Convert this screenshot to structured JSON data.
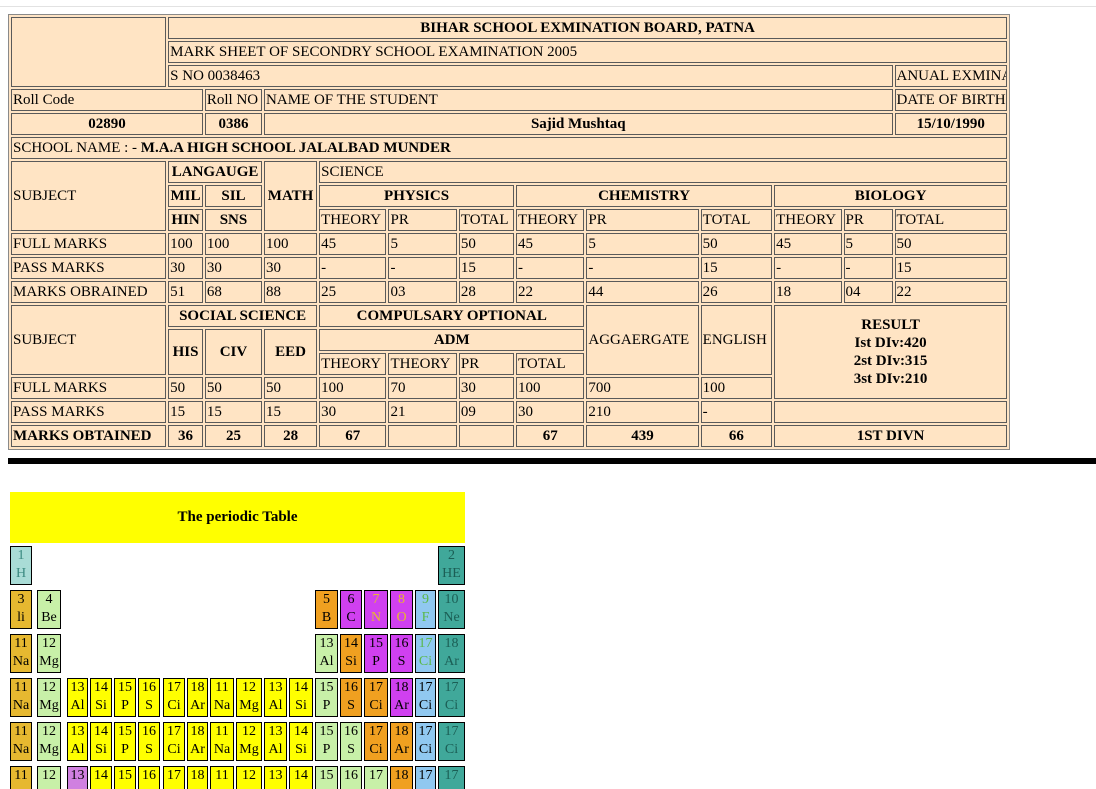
{
  "marksheet": {
    "board": "BIHAR SCHOOL EXMINATION BOARD, PATNA",
    "sheet_title": "MARK SHEET OF SECONDRY SCHOOL EXAMINATION 2005",
    "serial_no": "S NO 0038463",
    "exam_type": "ANUAL EXMINATION",
    "labels": {
      "roll_code": "Roll Code",
      "roll_no": "Roll NO",
      "student_name": "NAME OF THE STUDENT",
      "dob": "DATE OF BIRTH",
      "school_prefix": "SCHOOL NAME : -",
      "subject": "SUBJECT",
      "language": "LANGAUGE",
      "mil": "MIL",
      "sil": "SIL",
      "hin": "HIN",
      "sns": "SNS",
      "math": "MATH",
      "science": "SCIENCE",
      "physics": "PHYSICS",
      "chemistry": "CHEMISTRY",
      "biology": "BIOLOGY",
      "theory": "THEORY",
      "pr": "PR",
      "total": "TOTAL",
      "full_marks": "FULL MARKS",
      "pass_marks": "PASS MARKS",
      "marks_obrained": "MARKS OBRAINED",
      "marks_obtained": "MARKS OBTAINED",
      "social_science": "SOCIAL SCIENCE",
      "his": "HIS",
      "civ": "CIV",
      "eed": "EED",
      "compulsary_optional": "COMPULSARY OPTIONAL",
      "adm": "ADM",
      "aggregate": "AGGAERGATE",
      "english": "ENGLISH",
      "result": "RESULT",
      "div1": "Ist DIv:420",
      "div2": "2st DIv:315",
      "div3": "3st DIv:210"
    },
    "student": {
      "roll_code": "02890",
      "roll_no": "0386",
      "name": "Sajid Mushtaq",
      "dob": "15/10/1990",
      "school": "M.A.A HIGH SCHOOL JALALBAD MUNDER"
    },
    "part1": {
      "full": [
        "100",
        "100",
        "100",
        "45",
        "5",
        "50",
        "45",
        "5",
        "50",
        "45",
        "5",
        "50"
      ],
      "pass": [
        "30",
        "30",
        "30",
        "-",
        "-",
        "15",
        "-",
        "-",
        "15",
        "-",
        "-",
        "15"
      ],
      "obt": [
        "51",
        "68",
        "88",
        "25",
        "03",
        "28",
        "22",
        "44",
        "26",
        "18",
        "04",
        "22"
      ]
    },
    "part2": {
      "full": [
        "50",
        "50",
        "50",
        "100",
        "70",
        "30",
        "100",
        "700",
        "100"
      ],
      "pass": [
        "15",
        "15",
        "15",
        "30",
        "21",
        "09",
        "30",
        "210",
        "-"
      ],
      "obt": [
        "36",
        "25",
        "28",
        "67",
        "",
        "",
        "67",
        "439",
        "66"
      ],
      "result": "1ST DIVN"
    }
  },
  "periodic": {
    "title": "The periodic Table",
    "rows": [
      [
        {
          "col": 0,
          "n": "1",
          "s": "H",
          "bg": "#a9dcd6",
          "fg": "#3b8a80"
        },
        {
          "col": 17,
          "n": "2",
          "s": "HE",
          "bg": "#40a89a",
          "fg": "#1b5e55"
        }
      ],
      [
        {
          "col": 0,
          "n": "3",
          "s": "li",
          "bg": "#e6b830",
          "fg": "#000"
        },
        {
          "col": 1,
          "n": "4",
          "s": "Be",
          "bg": "#c8f0a8",
          "fg": "#000"
        },
        {
          "col": 12,
          "n": "5",
          "s": "B",
          "bg": "#f0a020",
          "fg": "#000"
        },
        {
          "col": 13,
          "n": "6",
          "s": "C",
          "bg": "#d040f0",
          "fg": "#000"
        },
        {
          "col": 14,
          "n": "7",
          "s": "N",
          "bg": "#d040f0",
          "fg": "#e6b830"
        },
        {
          "col": 15,
          "n": "8",
          "s": "O",
          "bg": "#d040f0",
          "fg": "#e6b830"
        },
        {
          "col": 16,
          "n": "9",
          "s": "F",
          "bg": "#90c8f0",
          "fg": "#5ab84a"
        },
        {
          "col": 17,
          "n": "10",
          "s": "Ne",
          "bg": "#40a89a",
          "fg": "#1b5e55"
        }
      ],
      [
        {
          "col": 0,
          "n": "11",
          "s": "Na",
          "bg": "#e6b830",
          "fg": "#000"
        },
        {
          "col": 1,
          "n": "12",
          "s": "Mg",
          "bg": "#c8f0a8",
          "fg": "#000"
        },
        {
          "col": 12,
          "n": "13",
          "s": "Al",
          "bg": "#c8f0a8",
          "fg": "#000"
        },
        {
          "col": 13,
          "n": "14",
          "s": "Si",
          "bg": "#f0a020",
          "fg": "#000"
        },
        {
          "col": 14,
          "n": "15",
          "s": "P",
          "bg": "#d040f0",
          "fg": "#000"
        },
        {
          "col": 15,
          "n": "16",
          "s": "S",
          "bg": "#d040f0",
          "fg": "#000"
        },
        {
          "col": 16,
          "n": "17",
          "s": "Ci",
          "bg": "#90c8f0",
          "fg": "#5ab84a"
        },
        {
          "col": 17,
          "n": "18",
          "s": "Ar",
          "bg": "#40a89a",
          "fg": "#1b5e55"
        }
      ],
      [
        {
          "col": 0,
          "n": "11",
          "s": "Na",
          "bg": "#e6b830",
          "fg": "#000"
        },
        {
          "col": 1,
          "n": "12",
          "s": "Mg",
          "bg": "#c8f0a8",
          "fg": "#000"
        },
        {
          "col": 2,
          "n": "13",
          "s": "Al",
          "bg": "#ffff00",
          "fg": "#000"
        },
        {
          "col": 3,
          "n": "14",
          "s": "Si",
          "bg": "#ffff00",
          "fg": "#000"
        },
        {
          "col": 4,
          "n": "15",
          "s": "P",
          "bg": "#ffff00",
          "fg": "#000"
        },
        {
          "col": 5,
          "n": "16",
          "s": "S",
          "bg": "#ffff00",
          "fg": "#000"
        },
        {
          "col": 6,
          "n": "17",
          "s": "Ci",
          "bg": "#ffff00",
          "fg": "#000"
        },
        {
          "col": 7,
          "n": "18",
          "s": "Ar",
          "bg": "#ffff00",
          "fg": "#000"
        },
        {
          "col": 8,
          "n": "11",
          "s": "Na",
          "bg": "#ffff00",
          "fg": "#000"
        },
        {
          "col": 9,
          "n": "12",
          "s": "Mg",
          "bg": "#ffff00",
          "fg": "#000"
        },
        {
          "col": 10,
          "n": "13",
          "s": "Al",
          "bg": "#ffff00",
          "fg": "#000"
        },
        {
          "col": 11,
          "n": "14",
          "s": "Si",
          "bg": "#ffff00",
          "fg": "#000"
        },
        {
          "col": 12,
          "n": "15",
          "s": "P",
          "bg": "#c8f0a8",
          "fg": "#000"
        },
        {
          "col": 13,
          "n": "16",
          "s": "S",
          "bg": "#f0a020",
          "fg": "#000"
        },
        {
          "col": 14,
          "n": "17",
          "s": "Ci",
          "bg": "#f0a020",
          "fg": "#000"
        },
        {
          "col": 15,
          "n": "18",
          "s": "Ar",
          "bg": "#d040f0",
          "fg": "#000"
        },
        {
          "col": 16,
          "n": "17",
          "s": "Ci",
          "bg": "#90c8f0",
          "fg": "#000"
        },
        {
          "col": 17,
          "n": "17",
          "s": "Ci",
          "bg": "#40a89a",
          "fg": "#1b5e55"
        }
      ],
      [
        {
          "col": 0,
          "n": "11",
          "s": "Na",
          "bg": "#e6b830",
          "fg": "#000"
        },
        {
          "col": 1,
          "n": "12",
          "s": "Mg",
          "bg": "#c8f0a8",
          "fg": "#000"
        },
        {
          "col": 2,
          "n": "13",
          "s": "Al",
          "bg": "#ffff00",
          "fg": "#000"
        },
        {
          "col": 3,
          "n": "14",
          "s": "Si",
          "bg": "#ffff00",
          "fg": "#000"
        },
        {
          "col": 4,
          "n": "15",
          "s": "P",
          "bg": "#ffff00",
          "fg": "#000"
        },
        {
          "col": 5,
          "n": "16",
          "s": "S",
          "bg": "#ffff00",
          "fg": "#000"
        },
        {
          "col": 6,
          "n": "17",
          "s": "Ci",
          "bg": "#ffff00",
          "fg": "#000"
        },
        {
          "col": 7,
          "n": "18",
          "s": "Ar",
          "bg": "#ffff00",
          "fg": "#000"
        },
        {
          "col": 8,
          "n": "11",
          "s": "Na",
          "bg": "#ffff00",
          "fg": "#000"
        },
        {
          "col": 9,
          "n": "12",
          "s": "Mg",
          "bg": "#ffff00",
          "fg": "#000"
        },
        {
          "col": 10,
          "n": "13",
          "s": "Al",
          "bg": "#ffff00",
          "fg": "#000"
        },
        {
          "col": 11,
          "n": "14",
          "s": "Si",
          "bg": "#ffff00",
          "fg": "#000"
        },
        {
          "col": 12,
          "n": "15",
          "s": "P",
          "bg": "#c8f0a8",
          "fg": "#000"
        },
        {
          "col": 13,
          "n": "16",
          "s": "S",
          "bg": "#c8f0a8",
          "fg": "#000"
        },
        {
          "col": 14,
          "n": "17",
          "s": "Ci",
          "bg": "#f0a020",
          "fg": "#000"
        },
        {
          "col": 15,
          "n": "18",
          "s": "Ar",
          "bg": "#f0a020",
          "fg": "#000"
        },
        {
          "col": 16,
          "n": "17",
          "s": "Ci",
          "bg": "#90c8f0",
          "fg": "#000"
        },
        {
          "col": 17,
          "n": "17",
          "s": "Ci",
          "bg": "#40a89a",
          "fg": "#1b5e55"
        }
      ],
      [
        {
          "col": 0,
          "n": "11",
          "s": "",
          "bg": "#e6b830",
          "fg": "#000"
        },
        {
          "col": 1,
          "n": "12",
          "s": "",
          "bg": "#c8f0a8",
          "fg": "#000"
        },
        {
          "col": 2,
          "n": "13",
          "s": "",
          "bg": "#d080e0",
          "fg": "#000"
        },
        {
          "col": 3,
          "n": "14",
          "s": "",
          "bg": "#ffff00",
          "fg": "#000"
        },
        {
          "col": 4,
          "n": "15",
          "s": "",
          "bg": "#ffff00",
          "fg": "#000"
        },
        {
          "col": 5,
          "n": "16",
          "s": "",
          "bg": "#ffff00",
          "fg": "#000"
        },
        {
          "col": 6,
          "n": "17",
          "s": "",
          "bg": "#ffff00",
          "fg": "#000"
        },
        {
          "col": 7,
          "n": "18",
          "s": "",
          "bg": "#ffff00",
          "fg": "#000"
        },
        {
          "col": 8,
          "n": "11",
          "s": "",
          "bg": "#ffff00",
          "fg": "#000"
        },
        {
          "col": 9,
          "n": "12",
          "s": "",
          "bg": "#ffff00",
          "fg": "#000"
        },
        {
          "col": 10,
          "n": "13",
          "s": "",
          "bg": "#ffff00",
          "fg": "#000"
        },
        {
          "col": 11,
          "n": "14",
          "s": "",
          "bg": "#ffff00",
          "fg": "#000"
        },
        {
          "col": 12,
          "n": "15",
          "s": "",
          "bg": "#c8f0a8",
          "fg": "#000"
        },
        {
          "col": 13,
          "n": "16",
          "s": "",
          "bg": "#c8f0a8",
          "fg": "#000"
        },
        {
          "col": 14,
          "n": "17",
          "s": "",
          "bg": "#c8f0a8",
          "fg": "#000"
        },
        {
          "col": 15,
          "n": "18",
          "s": "",
          "bg": "#f0a020",
          "fg": "#000"
        },
        {
          "col": 16,
          "n": "17",
          "s": "",
          "bg": "#90c8f0",
          "fg": "#000"
        },
        {
          "col": 17,
          "n": "17",
          "s": "",
          "bg": "#40a89a",
          "fg": "#1b5e55"
        }
      ]
    ]
  }
}
